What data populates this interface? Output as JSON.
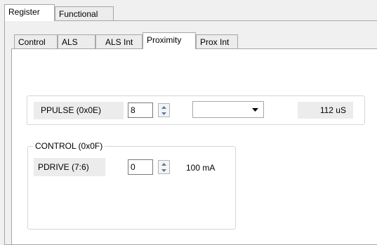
{
  "outer_tabs": [
    {
      "label": "Register",
      "selected": true
    },
    {
      "label": "Functional",
      "selected": false
    }
  ],
  "inner_tabs": [
    {
      "label": "Control",
      "selected": false
    },
    {
      "label": "ALS",
      "selected": false
    },
    {
      "label": "ALS Int",
      "selected": false
    },
    {
      "label": "Proximity",
      "selected": true
    },
    {
      "label": "Prox Int",
      "selected": false
    }
  ],
  "ppulse": {
    "label": "PPULSE (0x0E)",
    "value": "8",
    "dropdown_value": "",
    "readout": "112 uS"
  },
  "control": {
    "group_title": "CONTROL (0x0F)",
    "pdrive_label": "PDRIVE (7:6)",
    "pdrive_value": "0",
    "pdrive_readout": "100 mA"
  },
  "colors": {
    "window_bg": "#f0f0f0",
    "panel_bg": "#ffffff",
    "label_bg": "#ececec",
    "tab_border": "#a7a7a7"
  }
}
